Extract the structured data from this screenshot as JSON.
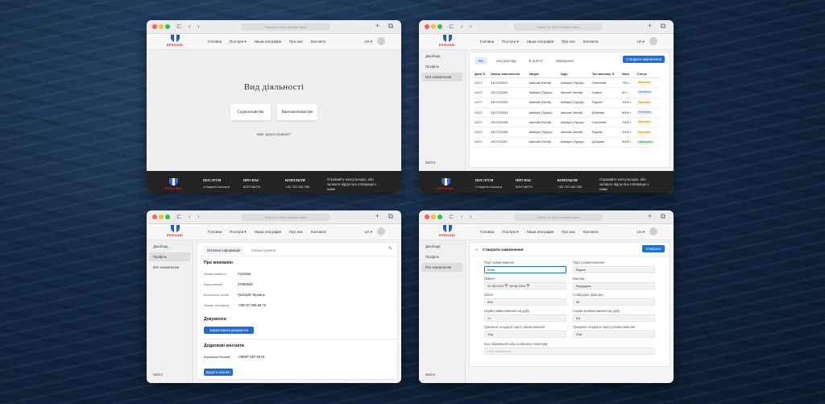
{
  "browser": {
    "url_placeholder": "Search or enter website name",
    "nav_icons": "⊏ ‹ ›",
    "right_icons": "+ ⧉"
  },
  "brand": {
    "logo_text": "EPROSBI",
    "accent": "#1f5fbf",
    "red": "#d22222"
  },
  "nav": {
    "links": [
      "Головна",
      "Послуги ▾",
      "Наша географія",
      "Про нас",
      "Контакти"
    ],
    "lang": "UA ▾"
  },
  "sidebar": {
    "items": [
      "Дашборд",
      "Профіль",
      "Мої замовлення"
    ],
    "exit": "Вийти"
  },
  "footer": {
    "col1_title": "ПОСЛУГИ",
    "col1_item": "Створити послуги",
    "col2_title": "ПРО НАС",
    "col2_item": "КОНТАКТИ",
    "col3_title": "КОНТАКТИ",
    "col3_item": "+38 725 265 365",
    "text": "Отримайте консультацію, або залиште відгук про співпрацю з нами"
  },
  "w1": {
    "title": "Вид діяльності",
    "btn1": "Судноплавство",
    "btn2": "Вантажоплавство",
    "note": "Вже зареєстровані?"
  },
  "w2": {
    "tabs": [
      "Всі",
      "На розгляді",
      "В роботі",
      "Завершені"
    ],
    "create_btn": "Створити замовлення",
    "columns": [
      "Дата ⇅",
      "Номер замовлення",
      "Звідки",
      "Куди",
      "Тип вантажу ⇅",
      "Вага",
      "Статус"
    ],
    "rows": [
      [
        "24.07",
        "2407202301",
        "Шанхай (Китай)",
        "Амбарлі (Турція)",
        "Насипний",
        "700 т",
        "Виконано",
        "o"
      ],
      [
        "24.07",
        "2407202302",
        "Амбарлі (Турція)",
        "Шанхай (Китай)",
        "Нафта",
        "80 т",
        "Оплачено",
        "b"
      ],
      [
        "24.07",
        "2407202303",
        "Шанхай (Китай)",
        "Амбарлі (Турція)",
        "Рідинні",
        "1000 т",
        "Виконано",
        "o"
      ],
      [
        "24.07",
        "2407202304",
        "Амбарлі (Турція)",
        "Шанхай (Китай)",
        "Добрива",
        "8000 т",
        "Оплачено",
        "b"
      ],
      [
        "24.07",
        "2407202305",
        "Шанхай (Китай)",
        "Амбарлі (Турція)",
        "Насипний",
        "7000 т",
        "Виконано",
        "o"
      ],
      [
        "24.07",
        "2407202306",
        "Амбарлі (Турція)",
        "Шанхай (Китай)",
        "Рідинні",
        "1000 т",
        "Виконано",
        "o"
      ],
      [
        "24.07",
        "2407202307",
        "Шанхай (Китай)",
        "Амбарлі (Турція)",
        "Добрива",
        "8000 т",
        "Завершено",
        "g"
      ]
    ]
  },
  "w3": {
    "tabs": [
      "Основна інформація",
      "Налаштування"
    ],
    "company_title": "Про компанію",
    "fields": [
      [
        "Назва компанії",
        "Агроком"
      ],
      [
        "Код компанії",
        "37890546"
      ],
      [
        "Контактна особа",
        "Григорій Черниць"
      ],
      [
        "Номер телефону",
        "+380 97 695 58 76"
      ]
    ],
    "docs_title": "Документи",
    "docs_btn": "Завантажити документи",
    "extra_title": "Додаткові контакти",
    "extra_name": "Корнієнко Віталій",
    "extra_phone": "+38097 567 99 81",
    "add_btn": "Додати контакт"
  },
  "w4": {
    "back": "←",
    "title": "Створити замовлення",
    "submit": "Створити",
    "fields": [
      {
        "label": "Порт завантаження",
        "value": "Київ|",
        "col": 0,
        "row": 0,
        "focus": true
      },
      {
        "label": "Порт розвантаження",
        "value": "Варна",
        "col": 1,
        "row": 0
      },
      {
        "label": "Лейкен",
        "value": "02.08.2023   📅   08.08.2024   📅",
        "col": 0,
        "row": 1
      },
      {
        "label": "Вантаж",
        "value": "Кукурудза",
        "col": 1,
        "row": 1
      },
      {
        "label": "Обсяг",
        "value": "900",
        "col": 0,
        "row": 2
      },
      {
        "label": "Стивідорні фактори",
        "value": "30",
        "col": 1,
        "row": 2
      },
      {
        "label": "Норма завантаження на добу",
        "value": "1т",
        "col": 0,
        "row": 3
      },
      {
        "label": "Норма розвантаження на добу",
        "value": "Шт",
        "col": 1,
        "row": 3
      },
      {
        "label": "Граничне осадка в порту завантаження",
        "value": "10м",
        "col": 0,
        "row": 4
      },
      {
        "label": "Граничне осадка в порту розвантаження",
        "value": "20м",
        "col": 1,
        "row": 4
      }
    ],
    "notes_label": "Інші обмеження або особливості вантажу",
    "notes_placeholder": "Інші побажання"
  }
}
